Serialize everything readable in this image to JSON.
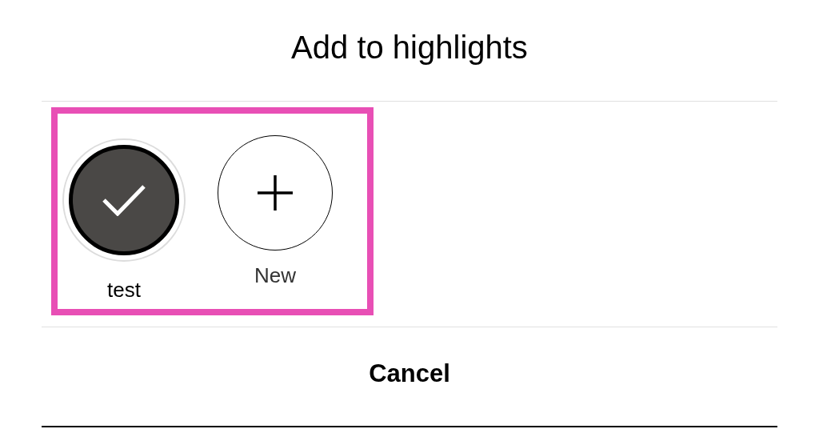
{
  "title": "Add to highlights",
  "highlights": [
    {
      "kind": "highlight",
      "label": "test",
      "selected": true
    },
    {
      "kind": "new",
      "label": "New",
      "selected": false
    }
  ],
  "cancel_button": "Cancel"
}
